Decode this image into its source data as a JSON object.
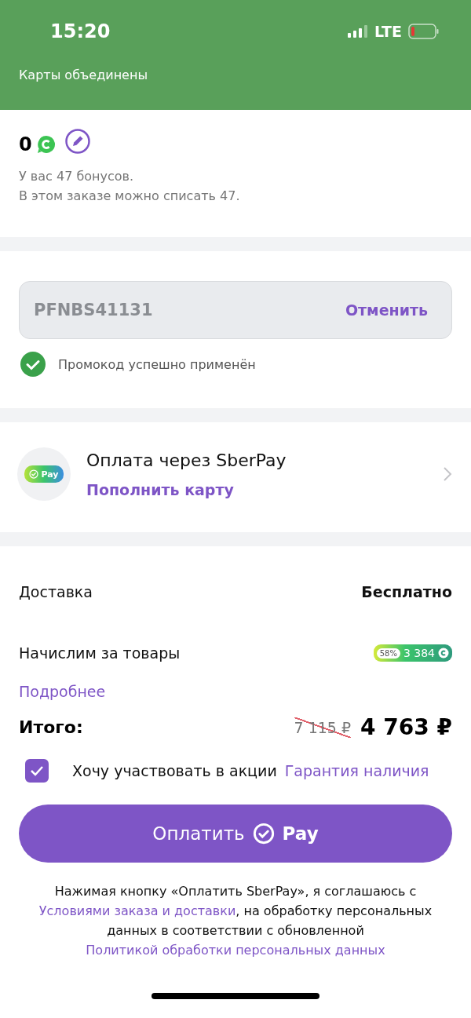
{
  "status_bar": {
    "time": "15:20",
    "network": "LTE"
  },
  "header": {
    "title": "Карты объединены"
  },
  "bonuses": {
    "amount": "0",
    "lines": [
      "У вас 47 бонусов.",
      "В этом заказе можно списать 47."
    ]
  },
  "promo": {
    "value": "PFNBS41131",
    "action": "Отменить",
    "applied": true,
    "message": "Промокод успешно применён"
  },
  "payment": {
    "logo_text": "Pay",
    "title": "Оплата через SberPay",
    "action": "Пополнить карту"
  },
  "summary": {
    "rows": [
      {
        "kind": "text",
        "label": "Доставка",
        "value": "Бесплатно"
      },
      {
        "kind": "badge",
        "label": "Начислим за товары",
        "percent": "58%",
        "value": "3 384"
      }
    ],
    "more_link": "Подробнее",
    "total": {
      "label": "Итого:",
      "old_price": "7 115 ₽",
      "price": "4 763 ₽"
    }
  },
  "agreement": {
    "checked": true,
    "label": "Хочу участвовать в акции",
    "link": "Гарантия наличия"
  },
  "pay_button": {
    "label": "Оплатить",
    "brand": "Pay"
  },
  "legal": [
    {
      "kind": "text",
      "text": "Нажимая кнопку «Оплатить SberPay», я соглашаюсь с"
    },
    {
      "kind": "link",
      "text": "Условиями заказа и доставки"
    },
    {
      "kind": "text",
      "text": ", на обработку персональных данных в соответствии с обновленной"
    },
    {
      "kind": "link",
      "text": "Политикой обработки персональных данных"
    }
  ]
}
